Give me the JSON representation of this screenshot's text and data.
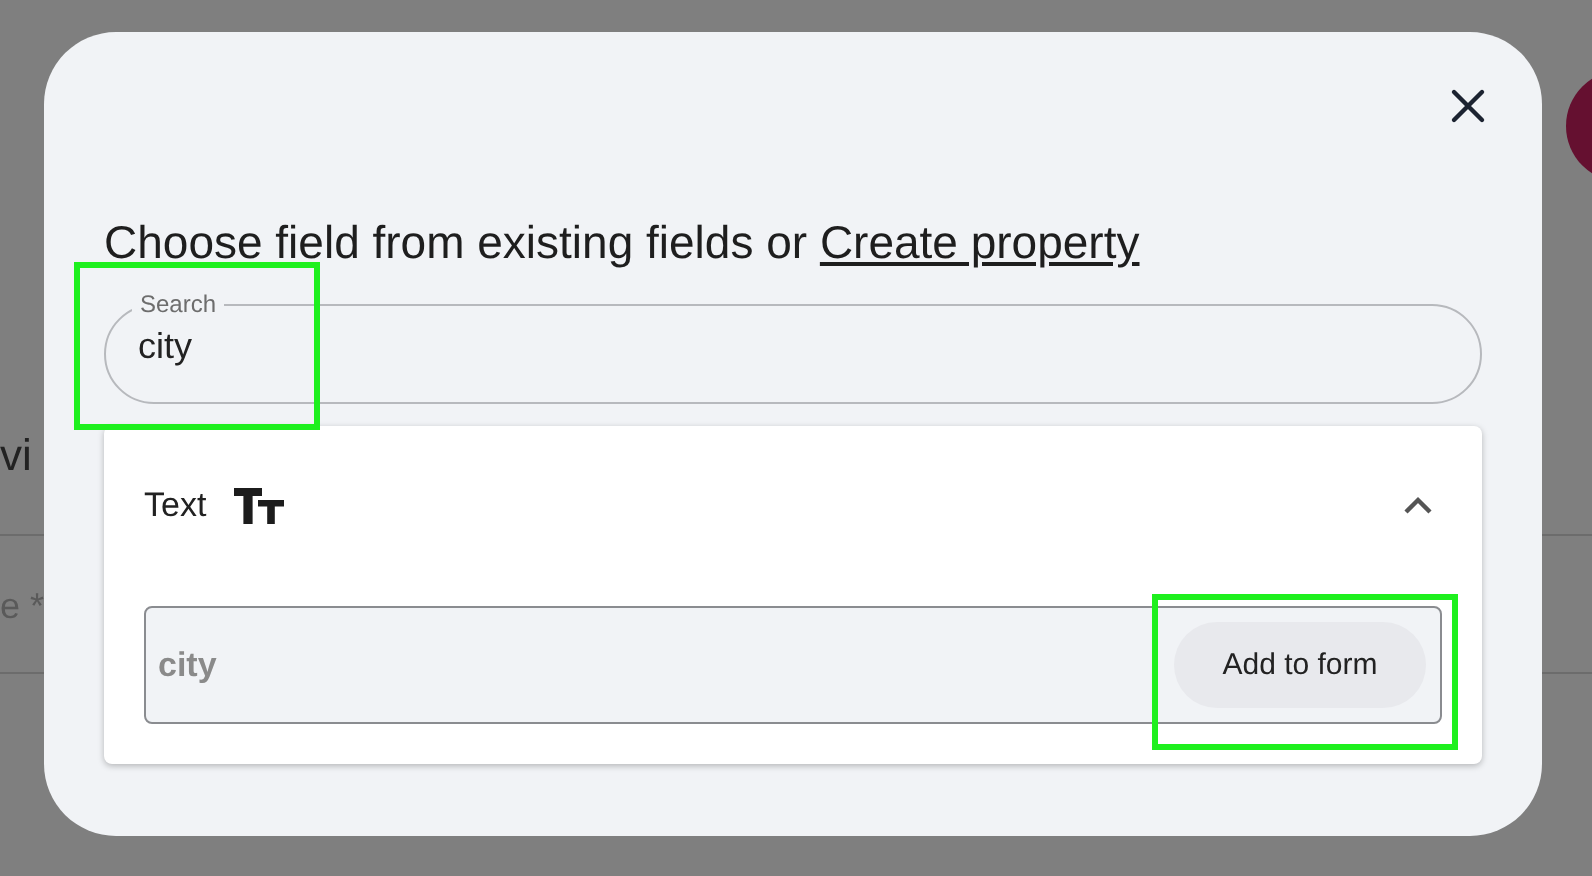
{
  "background": {
    "texts": [
      "vi",
      "e *"
    ]
  },
  "dialog": {
    "heading": "Choose field from existing fields or",
    "link": "Create property",
    "search": {
      "label": "Search",
      "value": "city",
      "highlighted": true
    },
    "groups": [
      {
        "title": "Text",
        "expanded": true,
        "fields": [
          {
            "name": "city",
            "action": "Add to form",
            "highlighted": true
          }
        ]
      }
    ]
  }
}
